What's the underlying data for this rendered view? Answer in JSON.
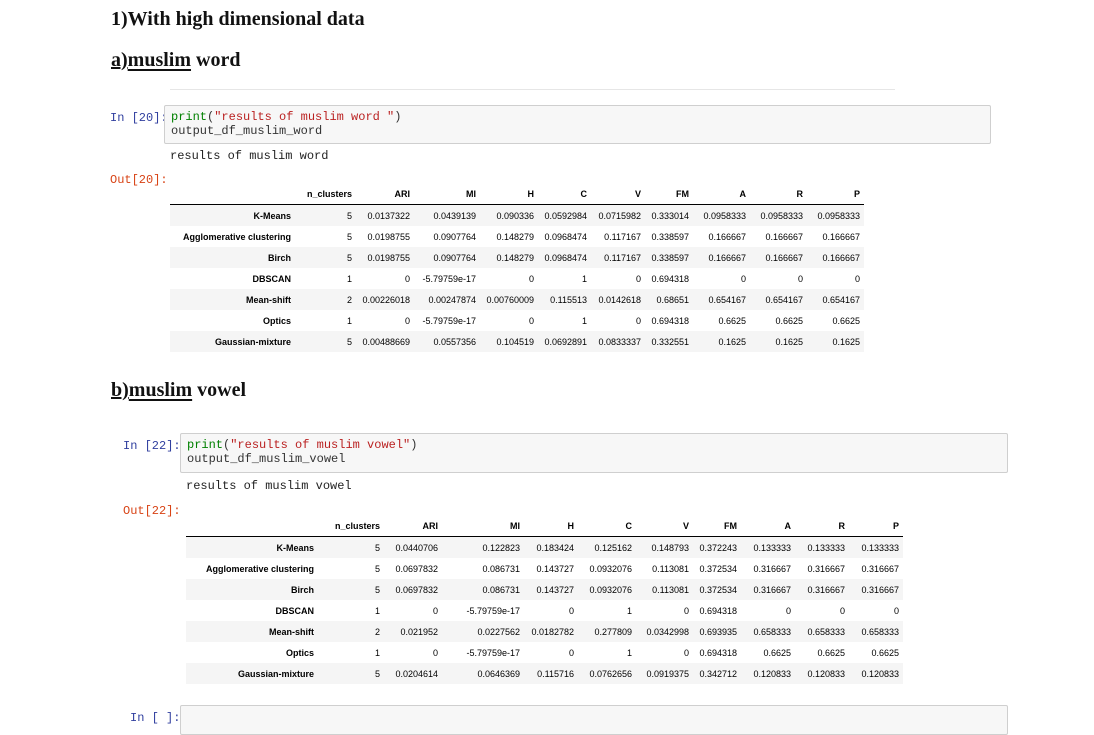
{
  "heading_main": "1)With high dimensional data",
  "section_a": {
    "prefix": "a)",
    "word": "muslim",
    "rest": " word"
  },
  "section_b": {
    "prefix": "b)",
    "word": "muslim",
    "rest": " vowel"
  },
  "cells": [
    {
      "in_prompt": "In [20]:",
      "code_line1_func": "print",
      "code_line1_str": "\"results of muslim word \"",
      "code_line2": "output_df_muslim_word",
      "stdout": "results of muslim word",
      "out_prompt": "Out[20]:"
    },
    {
      "in_prompt": "In [22]:",
      "code_line1_func": "print",
      "code_line1_str": "\"results of muslim vowel\"",
      "code_line2": "output_df_muslim_vowel",
      "stdout": "results of muslim vowel",
      "out_prompt": "Out[22]:"
    }
  ],
  "empty_prompt": "In [ ]:",
  "columns": [
    "n_clusters",
    "ARI",
    "MI",
    "H",
    "C",
    "V",
    "FM",
    "A",
    "R",
    "P"
  ],
  "table_word": [
    [
      "K-Means",
      "5",
      "0.0137322",
      "0.0439139",
      "0.090336",
      "0.0592984",
      "0.0715982",
      "0.333014",
      "0.0958333",
      "0.0958333",
      "0.0958333"
    ],
    [
      "Agglomerative clustering",
      "5",
      "0.0198755",
      "0.0907764",
      "0.148279",
      "0.0968474",
      "0.117167",
      "0.338597",
      "0.166667",
      "0.166667",
      "0.166667"
    ],
    [
      "Birch",
      "5",
      "0.0198755",
      "0.0907764",
      "0.148279",
      "0.0968474",
      "0.117167",
      "0.338597",
      "0.166667",
      "0.166667",
      "0.166667"
    ],
    [
      "DBSCAN",
      "1",
      "0",
      "-5.79759e-17",
      "0",
      "1",
      "0",
      "0.694318",
      "0",
      "0",
      "0"
    ],
    [
      "Mean-shift",
      "2",
      "0.00226018",
      "0.00247874",
      "0.00760009",
      "0.115513",
      "0.0142618",
      "0.68651",
      "0.654167",
      "0.654167",
      "0.654167"
    ],
    [
      "Optics",
      "1",
      "0",
      "-5.79759e-17",
      "0",
      "1",
      "0",
      "0.694318",
      "0.6625",
      "0.6625",
      "0.6625"
    ],
    [
      "Gaussian-mixture",
      "5",
      "0.00488669",
      "0.0557356",
      "0.104519",
      "0.0692891",
      "0.0833337",
      "0.332551",
      "0.1625",
      "0.1625",
      "0.1625"
    ]
  ],
  "table_vowel": [
    [
      "K-Means",
      "5",
      "0.0440706",
      "0.122823",
      "0.183424",
      "0.125162",
      "0.148793",
      "0.372243",
      "0.133333",
      "0.133333",
      "0.133333"
    ],
    [
      "Agglomerative clustering",
      "5",
      "0.0697832",
      "0.086731",
      "0.143727",
      "0.0932076",
      "0.113081",
      "0.372534",
      "0.316667",
      "0.316667",
      "0.316667"
    ],
    [
      "Birch",
      "5",
      "0.0697832",
      "0.086731",
      "0.143727",
      "0.0932076",
      "0.113081",
      "0.372534",
      "0.316667",
      "0.316667",
      "0.316667"
    ],
    [
      "DBSCAN",
      "1",
      "0",
      "-5.79759e-17",
      "0",
      "1",
      "0",
      "0.694318",
      "0",
      "0",
      "0"
    ],
    [
      "Mean-shift",
      "2",
      "0.021952",
      "0.0227562",
      "0.0182782",
      "0.277809",
      "0.0342998",
      "0.693935",
      "0.658333",
      "0.658333",
      "0.658333"
    ],
    [
      "Optics",
      "1",
      "0",
      "-5.79759e-17",
      "0",
      "1",
      "0",
      "0.694318",
      "0.6625",
      "0.6625",
      "0.6625"
    ],
    [
      "Gaussian-mixture",
      "5",
      "0.0204614",
      "0.0646369",
      "0.115716",
      "0.0762656",
      "0.0919375",
      "0.342712",
      "0.120833",
      "0.120833",
      "0.120833"
    ]
  ]
}
